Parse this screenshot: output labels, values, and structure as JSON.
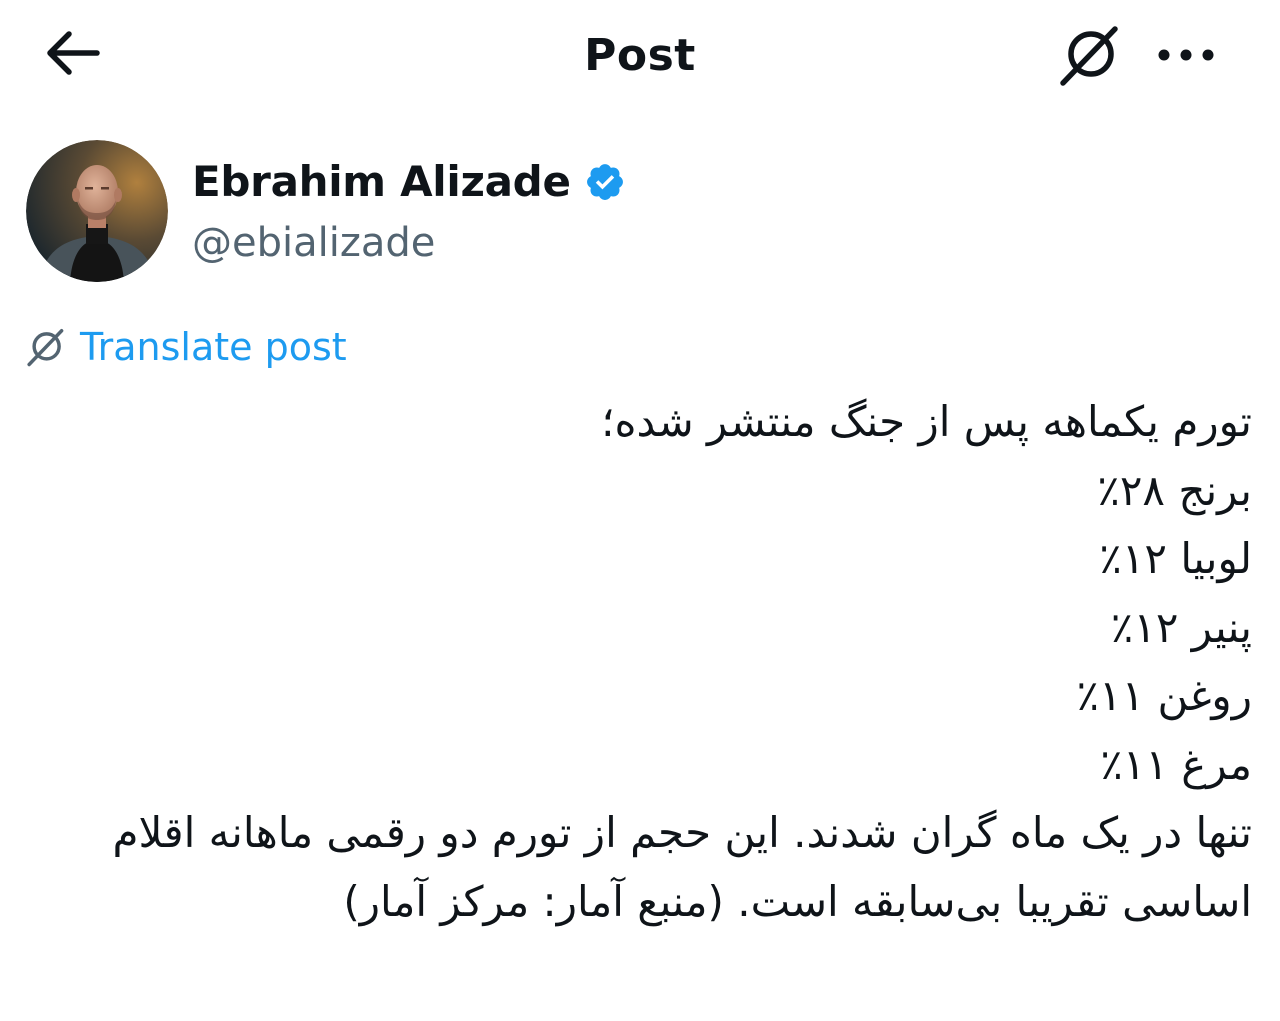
{
  "header": {
    "title": "Post",
    "back_icon": "arrow-left-icon",
    "grok_icon": "grok-icon",
    "more_icon": "ellipsis-icon"
  },
  "author": {
    "display_name": "Ebrahim Alizade",
    "handle": "@ebializade",
    "verified": true,
    "verified_color": "#1d9bf0"
  },
  "translate": {
    "label": "Translate post",
    "icon": "grok-icon",
    "color": "#1d9bf0"
  },
  "post": {
    "lines": [
      "تورم یکماهه پس از جنگ منتشر شده؛",
      "برنج ۲۸٪",
      "لوبیا ۱۲٪",
      "پنیر ۱۲٪",
      "روغن ۱۱٪",
      "مرغ ۱۱٪"
    ],
    "paragraph": "تنها در یک ماه گران شدند. این حجم از تورم دو رقمی ماهانه اقلام اساسی تقریبا بی‌سابقه است. (منبع آمار: مرکز آمار)"
  },
  "colors": {
    "text_primary": "#0f1419",
    "text_secondary": "#536471",
    "accent": "#1d9bf0"
  }
}
